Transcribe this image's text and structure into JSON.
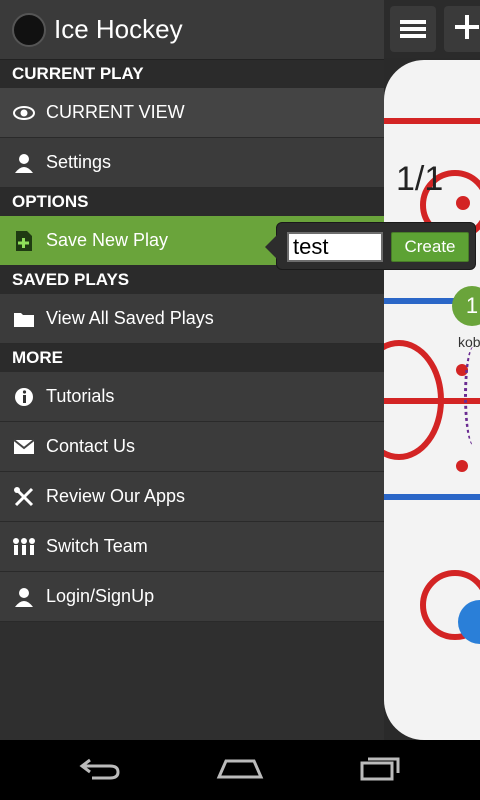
{
  "app": {
    "title": "Ice Hockey"
  },
  "header_right": {
    "menu_icon": "menu-icon",
    "add_icon": "plus-icon",
    "counter": "1/1"
  },
  "drawer": {
    "sections": [
      {
        "title": "CURRENT PLAY"
      },
      {
        "title": "OPTIONS"
      },
      {
        "title": "SAVED PLAYS"
      },
      {
        "title": "MORE"
      }
    ],
    "current_view": "CURRENT VIEW",
    "settings": "Settings",
    "save_new_play": "Save New Play",
    "view_all": "View All Saved Plays",
    "more_items": [
      {
        "label": "Tutorials",
        "icon": "info-icon"
      },
      {
        "label": "Contact Us",
        "icon": "mail-icon"
      },
      {
        "label": "Review Our Apps",
        "icon": "tools-icon"
      },
      {
        "label": "Switch Team",
        "icon": "team-icon"
      },
      {
        "label": "Login/SignUp",
        "icon": "user-icon"
      }
    ]
  },
  "popup": {
    "input_value": "test",
    "create_label": "Create"
  },
  "colors": {
    "accent_green": "#6aa43b",
    "rink_red": "#d32424",
    "rink_blue": "#2a66c7"
  },
  "rink": {
    "player_label": "kob"
  }
}
